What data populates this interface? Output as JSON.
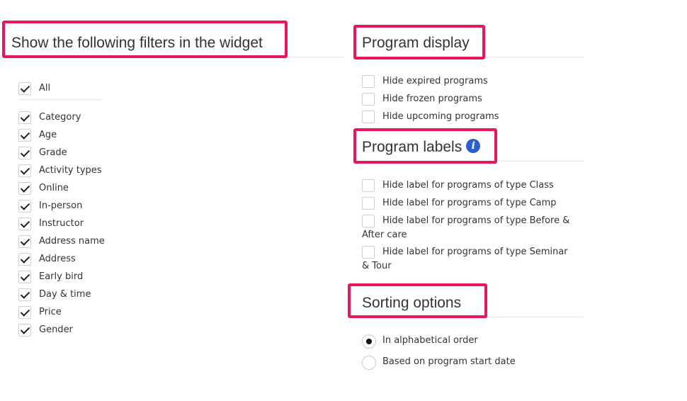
{
  "filters_section": {
    "title": "Show the following filters in the widget",
    "all_label": "All",
    "items": [
      {
        "label": "Category",
        "checked": true
      },
      {
        "label": "Age",
        "checked": true
      },
      {
        "label": "Grade",
        "checked": true
      },
      {
        "label": "Activity types",
        "checked": true
      },
      {
        "label": "Online",
        "checked": true
      },
      {
        "label": "In-person",
        "checked": true
      },
      {
        "label": "Instructor",
        "checked": true
      },
      {
        "label": "Address name",
        "checked": true
      },
      {
        "label": "Address",
        "checked": true
      },
      {
        "label": "Early bird",
        "checked": true
      },
      {
        "label": "Day & time",
        "checked": true
      },
      {
        "label": "Price",
        "checked": true
      },
      {
        "label": "Gender",
        "checked": true
      }
    ]
  },
  "program_display": {
    "title": "Program display",
    "items": [
      {
        "label": "Hide expired programs",
        "checked": false
      },
      {
        "label": "Hide frozen programs",
        "checked": false
      },
      {
        "label": "Hide upcoming programs",
        "checked": false
      }
    ]
  },
  "program_labels": {
    "title": "Program labels",
    "info_icon_glyph": "i",
    "items": [
      {
        "label": "Hide label for programs of type Class",
        "checked": false
      },
      {
        "label": "Hide label for programs of type Camp",
        "checked": false
      },
      {
        "label": "Hide label for programs of type Before & After care",
        "checked": false
      },
      {
        "label": "Hide label for programs of type Seminar & Tour",
        "checked": false
      }
    ]
  },
  "sorting_options": {
    "title": "Sorting options",
    "options": [
      {
        "label": "In alphabetical order",
        "selected": true
      },
      {
        "label": "Based on program start date",
        "selected": false
      }
    ]
  },
  "colors": {
    "highlight": "#e8175d",
    "info_icon": "#2b5fcb"
  }
}
